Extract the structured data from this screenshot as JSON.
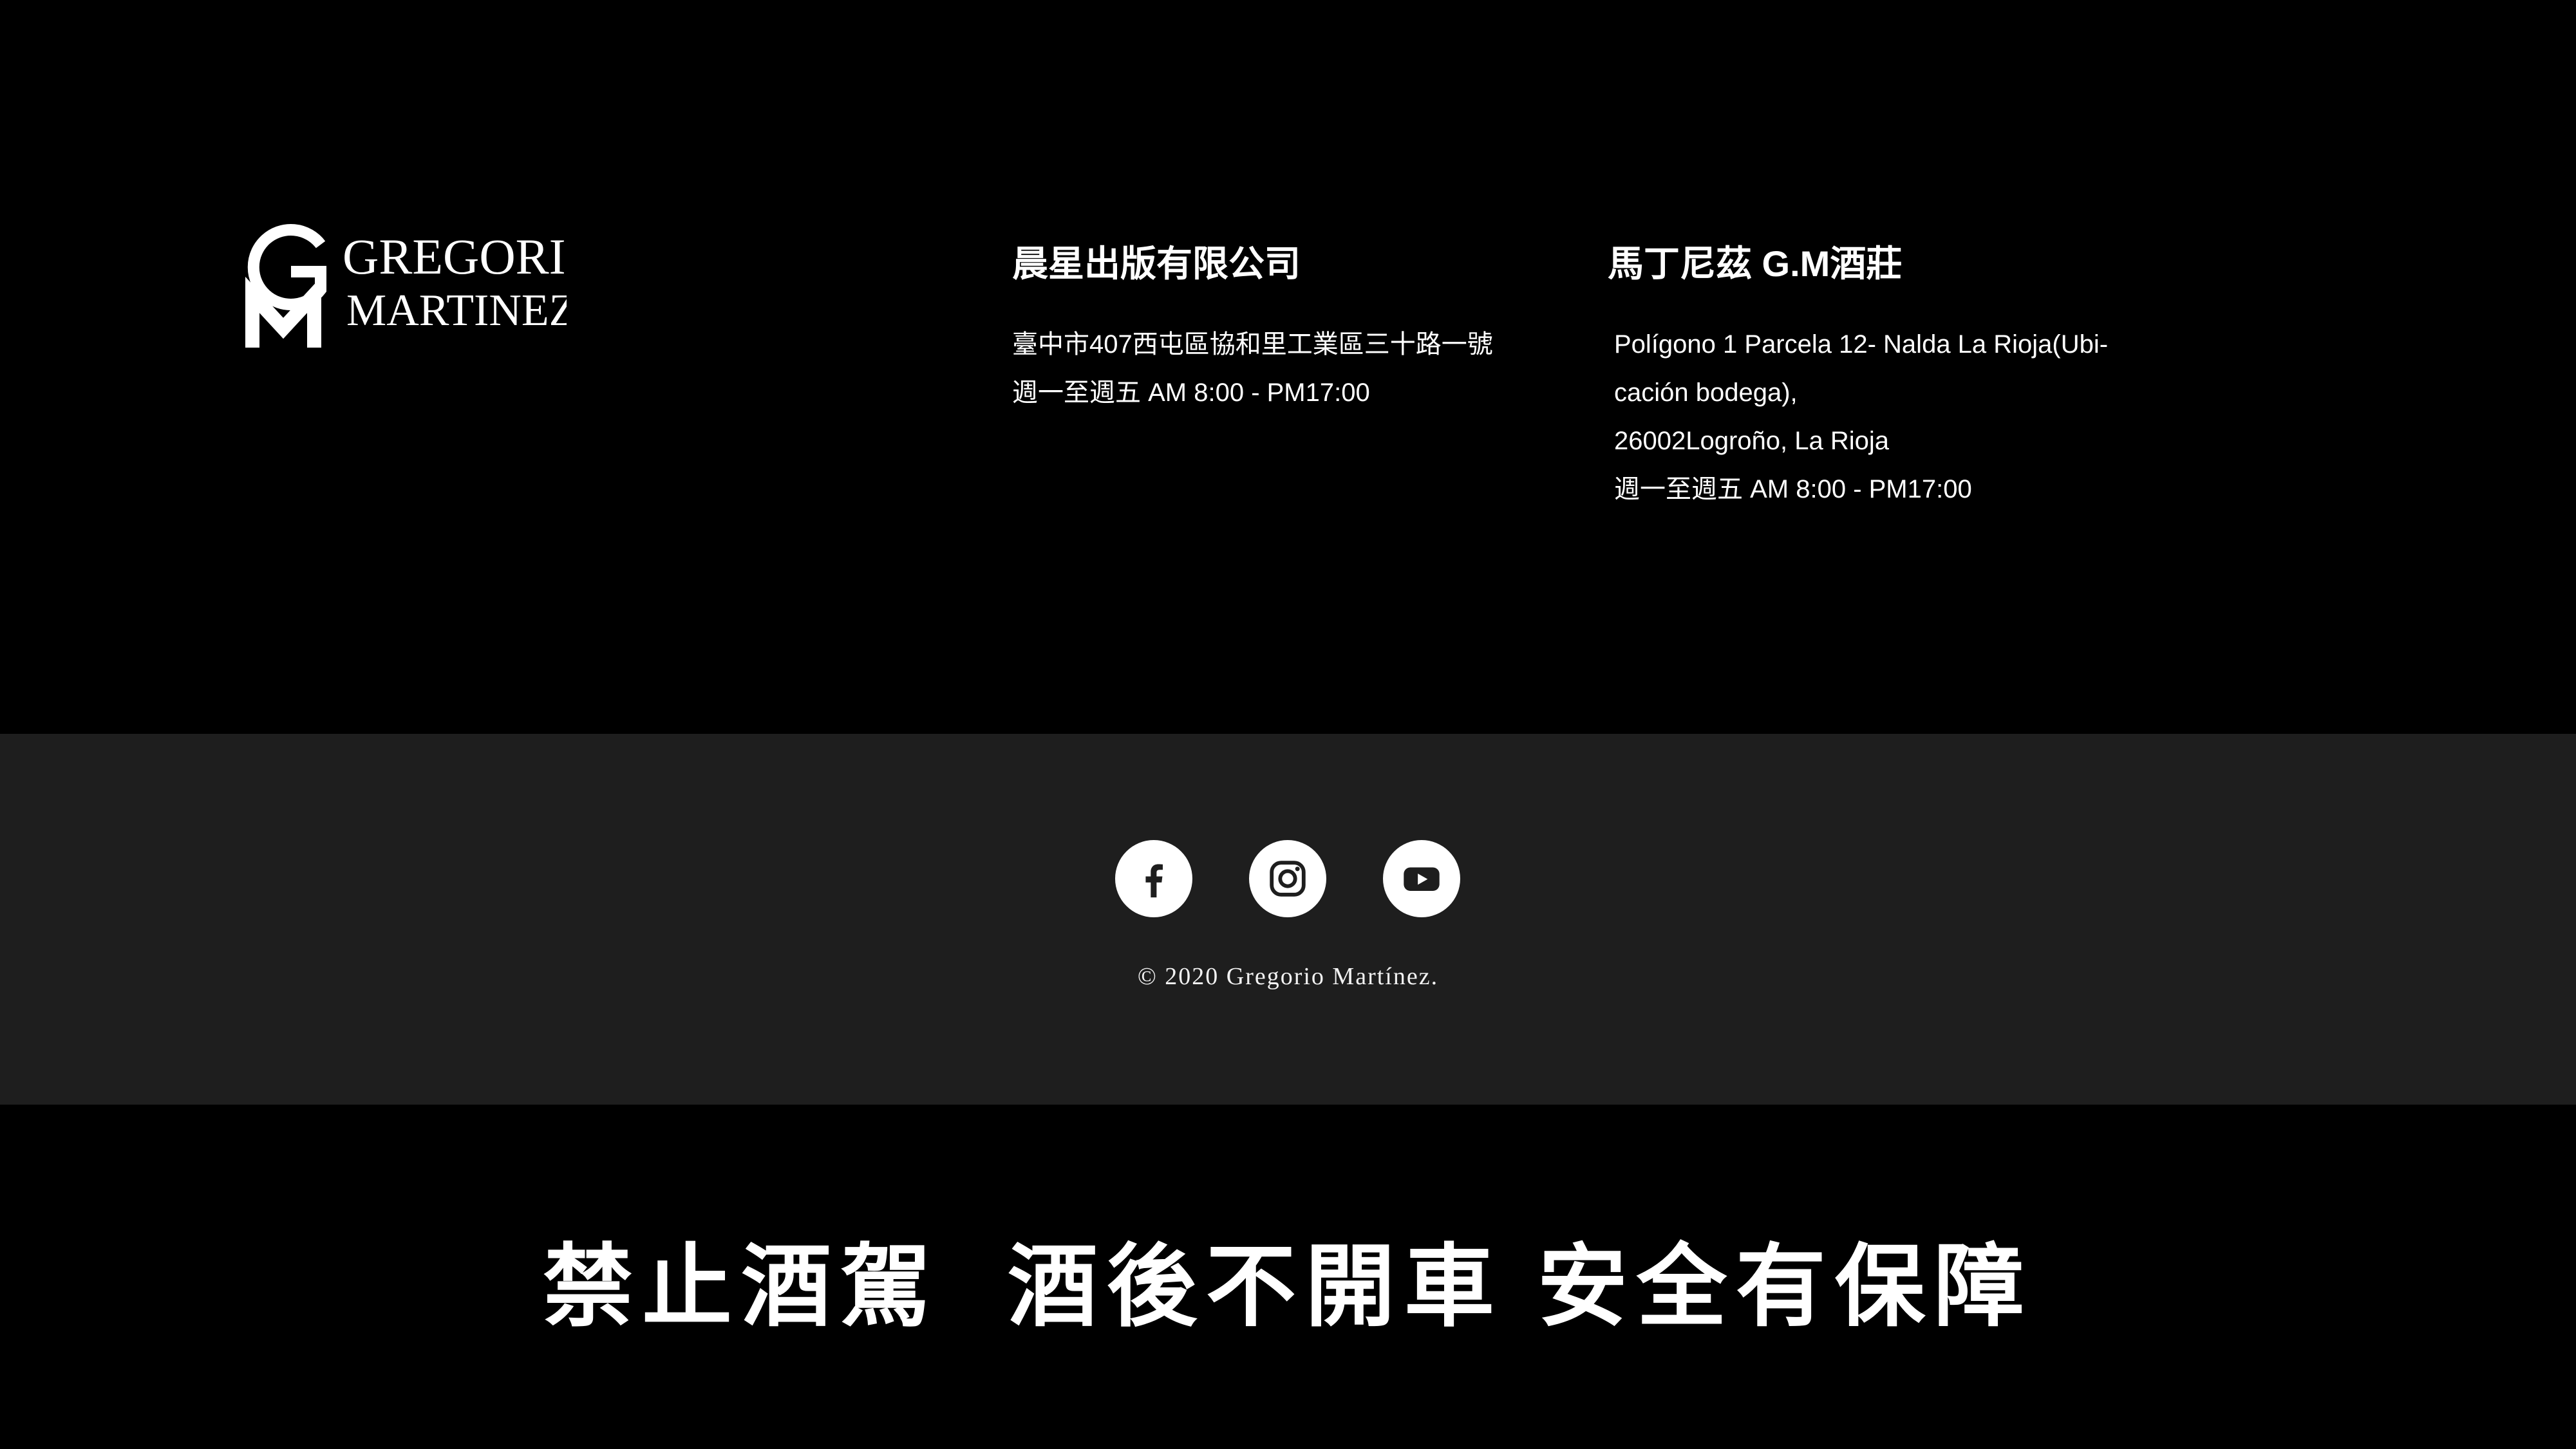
{
  "logo": {
    "line1": "GREGORIO",
    "line2": "MARTINEZ",
    "icon": "gm-monogram-icon"
  },
  "company": {
    "title": "晨星出版有限公司",
    "lines": [
      "臺中市407西屯區協和里工業區三十路一號",
      "週一至週五 AM 8:00 - PM17:00"
    ]
  },
  "winery": {
    "title": "馬丁尼茲 G.M酒莊",
    "lines": [
      "Polígono 1 Parcela 12- Nalda La Rioja(Ubi-",
      "cación bodega),",
      "26002Logroño, La Rioja",
      "週一至週五 AM 8:00 - PM17:00"
    ]
  },
  "social": [
    {
      "name": "facebook-icon"
    },
    {
      "name": "instagram-icon"
    },
    {
      "name": "youtube-icon"
    }
  ],
  "copyright": "© 2020 Gregorio Martínez.",
  "slogan": "禁止酒駕  酒後不開車 安全有保障",
  "colors": {
    "top_background": "#000000",
    "footer_background": "#1e1e1e",
    "text": "#ffffff"
  }
}
